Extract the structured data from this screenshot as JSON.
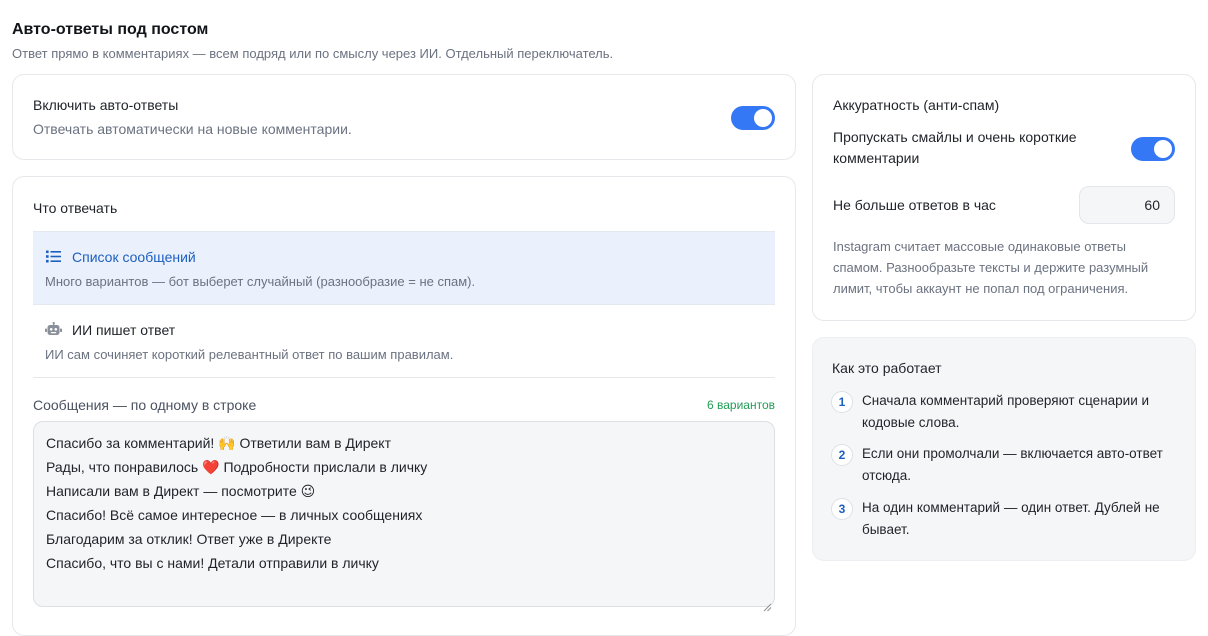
{
  "header": {
    "title": "Авто-ответы под постом",
    "subtitle": "Ответ прямо в комментариях — всем подряд или по смыслу через ИИ. Отдельный переключатель."
  },
  "enable": {
    "label": "Включить авто-ответы",
    "description": "Отвечать автоматически на новые комментарии.",
    "toggle_on": true
  },
  "reply": {
    "section_title": "Что отвечать",
    "modes": [
      {
        "icon": "list-icon",
        "label": "Список сообщений",
        "description": "Много вариантов — бот выберет случайный (разнообразие = не спам).",
        "selected": true
      },
      {
        "icon": "robot-icon",
        "label": "ИИ пишет ответ",
        "description": "ИИ сам сочиняет короткий релевантный ответ по вашим правилам.",
        "selected": false
      }
    ],
    "messages_label": "Сообщения — по одному в строке",
    "variants_count": "6 вариантов",
    "messages": [
      "Спасибо за комментарий! 🙌 Ответили вам в Директ",
      "Рады, что понравилось ❤️ Подробности прислали в личку",
      "Написали вам в Директ — посмотрите 😉",
      "Спасибо! Всё самое интересное — в личных сообщениях",
      "Благодарим за отклик! Ответ уже в Директе",
      "Спасибо, что вы с нами! Детали отправили в личку"
    ]
  },
  "accuracy": {
    "title": "Аккуратность (анти-спам)",
    "skip_label": "Пропускать смайлы и очень короткие комментарии",
    "skip_toggle_on": true,
    "limit_label": "Не больше ответов в час",
    "limit_value": "60",
    "note": "Instagram считает массовые одинаковые ответы спамом. Разнообразьте тексты и держите разумный лимит, чтобы аккаунт не попал под ограничения."
  },
  "how_it_works": {
    "title": "Как это работает",
    "steps": [
      {
        "num": "1",
        "text": "Сначала комментарий проверяют сценарии и кодовые слова."
      },
      {
        "num": "2",
        "text": "Если они промолчали — включается авто-ответ отсюда."
      },
      {
        "num": "3",
        "text": "На один комментарий — один ответ. Дублей не бывает."
      }
    ]
  },
  "colors": {
    "accent": "#3478f6",
    "selected_bg": "#eaf1fc",
    "selected_text": "#1d5fbf",
    "success": "#1f9d55"
  }
}
